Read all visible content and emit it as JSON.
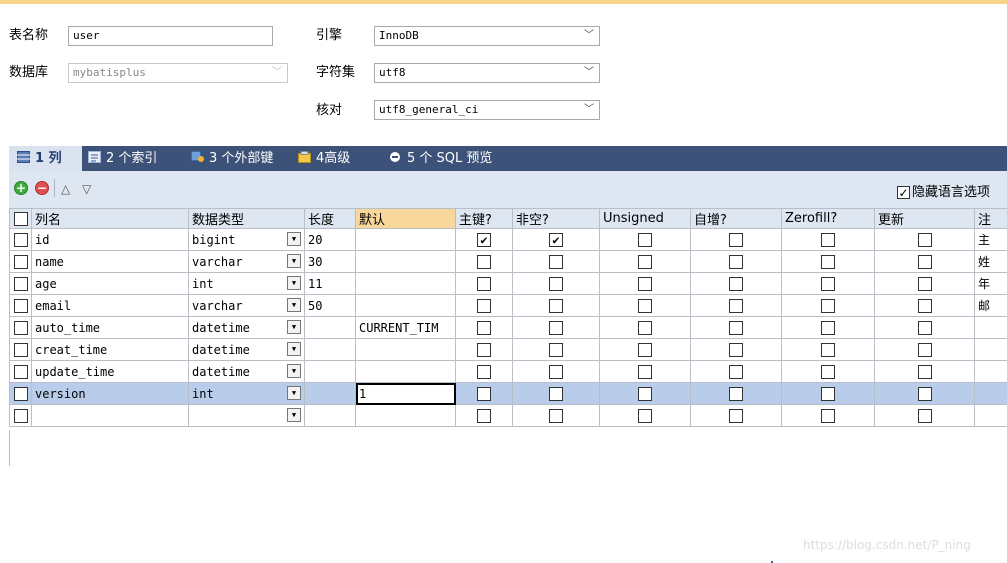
{
  "form": {
    "table_name_label": "表名称",
    "table_name_value": "user",
    "database_label": "数据库",
    "database_value": "mybatisplus",
    "engine_label": "引擎",
    "engine_value": "InnoDB",
    "charset_label": "字符集",
    "charset_value": "utf8",
    "collation_label": "核对",
    "collation_value": "utf8_general_ci"
  },
  "tabs": [
    {
      "label": "1 列",
      "icon": "grid-icon",
      "active": true
    },
    {
      "label": "2 个索引",
      "icon": "index-icon",
      "active": false
    },
    {
      "label": "3 个外部键",
      "icon": "foreign-key-icon",
      "active": false
    },
    {
      "label": "4高级",
      "icon": "advanced-icon",
      "active": false
    },
    {
      "label": "5 个 SQL 预览",
      "icon": "sql-preview-icon",
      "active": false
    }
  ],
  "toolbar": {
    "add_icon": "plus-circle-icon",
    "remove_icon": "minus-circle-icon",
    "up_icon": "triangle-up-icon",
    "down_icon": "triangle-down-icon",
    "hide_language_label": "隐藏语言选项",
    "hide_language_checked": true
  },
  "columns_header": {
    "name": "列名",
    "type": "数据类型",
    "length": "长度",
    "default": "默认",
    "pk": "主键?",
    "notnull": "非空?",
    "unsigned": "Unsigned",
    "autoinc": "自增?",
    "zerofill": "Zerofill?",
    "update": "更新",
    "comment": "注"
  },
  "rows": [
    {
      "name": "id",
      "type": "bigint",
      "length": "20",
      "default": "",
      "pk": true,
      "notnull": true,
      "comment": "主"
    },
    {
      "name": "name",
      "type": "varchar",
      "length": "30",
      "default": "",
      "pk": false,
      "notnull": false,
      "comment": "姓"
    },
    {
      "name": "age",
      "type": "int",
      "length": "11",
      "default": "",
      "pk": false,
      "notnull": false,
      "comment": "年"
    },
    {
      "name": "email",
      "type": "varchar",
      "length": "50",
      "default": "",
      "pk": false,
      "notnull": false,
      "comment": "邮"
    },
    {
      "name": "auto_time",
      "type": "datetime",
      "length": "",
      "default": "CURRENT_TIM",
      "pk": false,
      "notnull": false,
      "comment": ""
    },
    {
      "name": "creat_time",
      "type": "datetime",
      "length": "",
      "default": "",
      "pk": false,
      "notnull": false,
      "comment": ""
    },
    {
      "name": "update_time",
      "type": "datetime",
      "length": "",
      "default": "",
      "pk": false,
      "notnull": false,
      "comment": ""
    },
    {
      "name": "version",
      "type": "int",
      "length": "",
      "default": "1",
      "pk": false,
      "notnull": false,
      "comment": "",
      "selected": true
    },
    {
      "name": "",
      "type": "",
      "length": "",
      "default": "",
      "pk": false,
      "notnull": false,
      "comment": ""
    }
  ],
  "watermark": "https://blog.csdn.net/P_ning",
  "colors": {
    "tab_bar": "#3d5278",
    "active_tab": "#d9e2ee",
    "toolbar_bg": "#dde6f1",
    "selected_row": "#b9cdea",
    "header_highlight": "#f7d79a",
    "top_accent": "#f6d58a"
  }
}
